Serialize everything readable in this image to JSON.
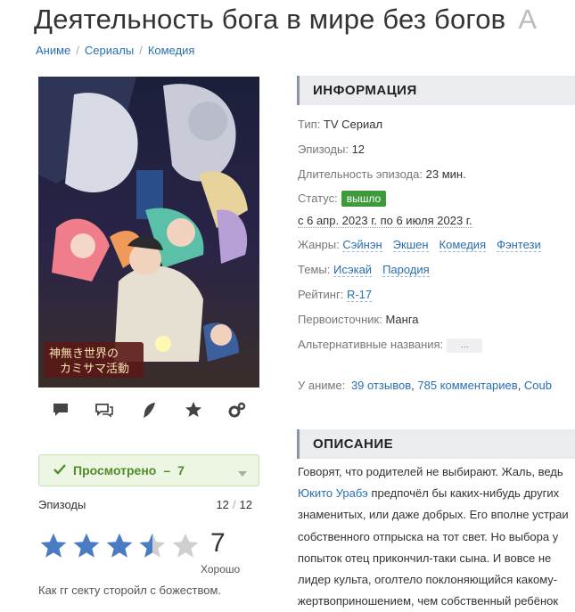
{
  "page": {
    "title": "Деятельность бога в мире без богов",
    "title_extra": "A"
  },
  "breadcrumb": [
    "Аниме",
    "Сериалы",
    "Комедия"
  ],
  "poster": {
    "logo_text_1": "神無き世界の",
    "logo_text_2": "カミサマ活動"
  },
  "actions": [
    "comment-icon",
    "comments-icon",
    "feather-icon",
    "star-icon",
    "cogs-icon"
  ],
  "status_block": {
    "watched_label": "Просмотрено",
    "watched_count": "7",
    "episodes_label": "Эпизоды",
    "episodes_watched": "12",
    "episodes_total": "12",
    "rating_value": "7",
    "rating_label": "Хорошо",
    "stars_fraction": 0.7,
    "quote": "Как гг секту сторойл с божеством."
  },
  "info": {
    "heading": "ИНФОРМАЦИЯ",
    "type_label": "Тип:",
    "type_value": "TV Сериал",
    "episodes_label": "Эпизоды:",
    "episodes_value": "12",
    "duration_label": "Длительность эпизода:",
    "duration_value": "23 мин.",
    "status_label": "Статус:",
    "status_value": "вышло",
    "dates": "с 6 апр. 2023 г. по 6 июля 2023 г.",
    "genres_label": "Жанры:",
    "genres": [
      "Сэйнэн",
      "Экшен",
      "Комедия",
      "Фэнтези"
    ],
    "themes_label": "Темы:",
    "themes": [
      "Исэкай",
      "Пародия"
    ],
    "rating_label": "Рейтинг:",
    "rating_value": "R-17",
    "source_label": "Первоисточник:",
    "source_value": "Манга",
    "alt_label": "Альтернативные названия:",
    "alt_button": "...",
    "anime_stats_label": "У аниме:",
    "anime_stats": [
      "39 отзывов",
      "785 комментариев",
      "Coub"
    ]
  },
  "description": {
    "heading": "ОПИСАНИЕ",
    "lines": [
      "Говорят, что родителей не выбирают. Жаль, ведь",
      "предпочёл бы каких-нибудь других",
      "знаменитых, или даже добрых. Его вполне устраи",
      "собственного отпрыска на тот свет. Но выбора у",
      "попыток отец прикончил-таки сына. И вовсе не",
      "лидер культа, оголтело поклоняющийся какому-",
      "жертвоприношением, чем собственный ребёнок"
    ],
    "character_name": "Юкито Урабэ"
  },
  "colors": {
    "accent_link": "#2a6fb0",
    "status_green": "#3e9a3a",
    "star_blue": "#4a7cc4",
    "watched_green": "#4f8d2b"
  }
}
